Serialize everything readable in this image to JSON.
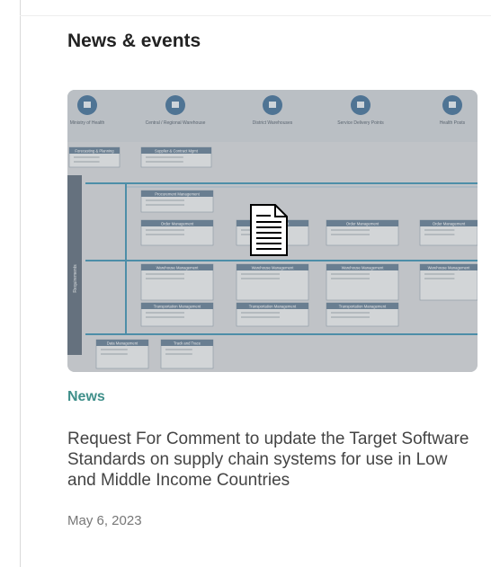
{
  "section": {
    "title": "News & events"
  },
  "card": {
    "category": "News",
    "headline": "Request For Comment to update the Target Software Standards on supply chain systems for use in Low and Middle Income Countries",
    "date": "May 6, 2023",
    "image": {
      "icon": "document-icon",
      "columns": [
        "Ministry of Health",
        "Central / Regional Warehouse",
        "District Warehouses",
        "Service Delivery Points",
        "Health Posts"
      ],
      "side_label": "Requirements",
      "boxes": [
        "Forecasting & Planning",
        "Supplier & Contract Mgmt",
        "Procurement Management",
        "Order Management",
        "Order Management",
        "Order Management",
        "Order Management",
        "Warehouse Management",
        "Warehouse Management",
        "Warehouse Management",
        "Warehouse Management",
        "Transportation Management",
        "Transportation Management",
        "Transportation Management",
        "Data Management",
        "Track and Trace"
      ]
    }
  }
}
